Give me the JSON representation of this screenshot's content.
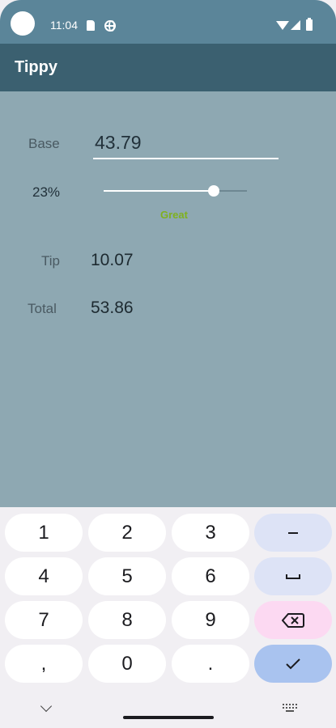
{
  "status_bar": {
    "time": "11:04",
    "icons": [
      "notification-dot",
      "sim-card-icon",
      "globe-icon",
      "wifi-icon",
      "signal-icon",
      "battery-icon"
    ]
  },
  "app_bar": {
    "title": "Tippy"
  },
  "calculator": {
    "base_label": "Base",
    "base_value": "43.79",
    "percent_label": "23%",
    "tip_percent": 23,
    "slider_fraction": 0.77,
    "rating": "Great",
    "tip_label": "Tip",
    "tip_value": "10.07",
    "total_label": "Total",
    "total_value": "53.86"
  },
  "keyboard": {
    "rows": [
      [
        "1",
        "2",
        "3"
      ],
      [
        "4",
        "5",
        "6"
      ],
      [
        "7",
        "8",
        "9"
      ],
      [
        ",",
        "0",
        "."
      ]
    ],
    "side_keys": [
      "minus-icon",
      "space-icon",
      "backspace-icon",
      "check-icon"
    ]
  },
  "colors": {
    "status_bar": "#5b8599",
    "app_bar": "#3b6070",
    "content_bg": "#8ea8b2",
    "rating_color": "#7fb11e",
    "key_fn": "#dde3f6",
    "key_delete": "#fcd9f2",
    "key_done": "#a9c3ef"
  }
}
